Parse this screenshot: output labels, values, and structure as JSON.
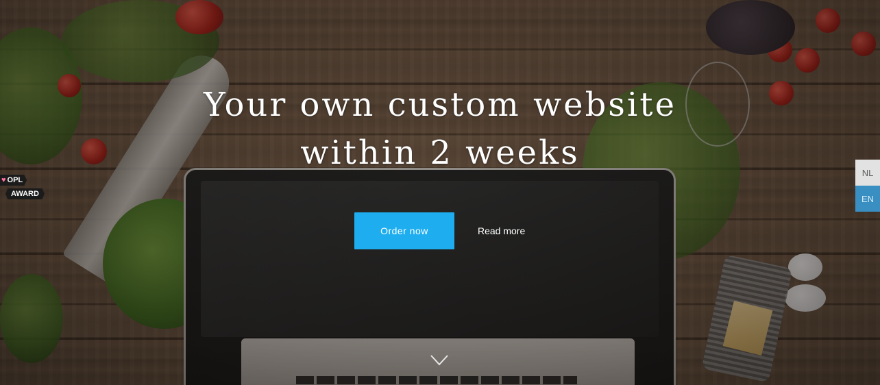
{
  "hero": {
    "title_line1": "Your own custom website",
    "title_line2": "within 2 weeks",
    "order_label": "Order now",
    "read_more_label": "Read more",
    "scroll_icon": "chevron-down-icon"
  },
  "award": {
    "line1": "OPL",
    "line2": "AWARD",
    "icon": "heart-icon"
  },
  "language": {
    "options": [
      "NL",
      "EN"
    ],
    "selected": "EN"
  },
  "colors": {
    "accent": "#1eaef0",
    "lang_active": "#3a8fc2",
    "lang_inactive": "#e2e2e2"
  }
}
